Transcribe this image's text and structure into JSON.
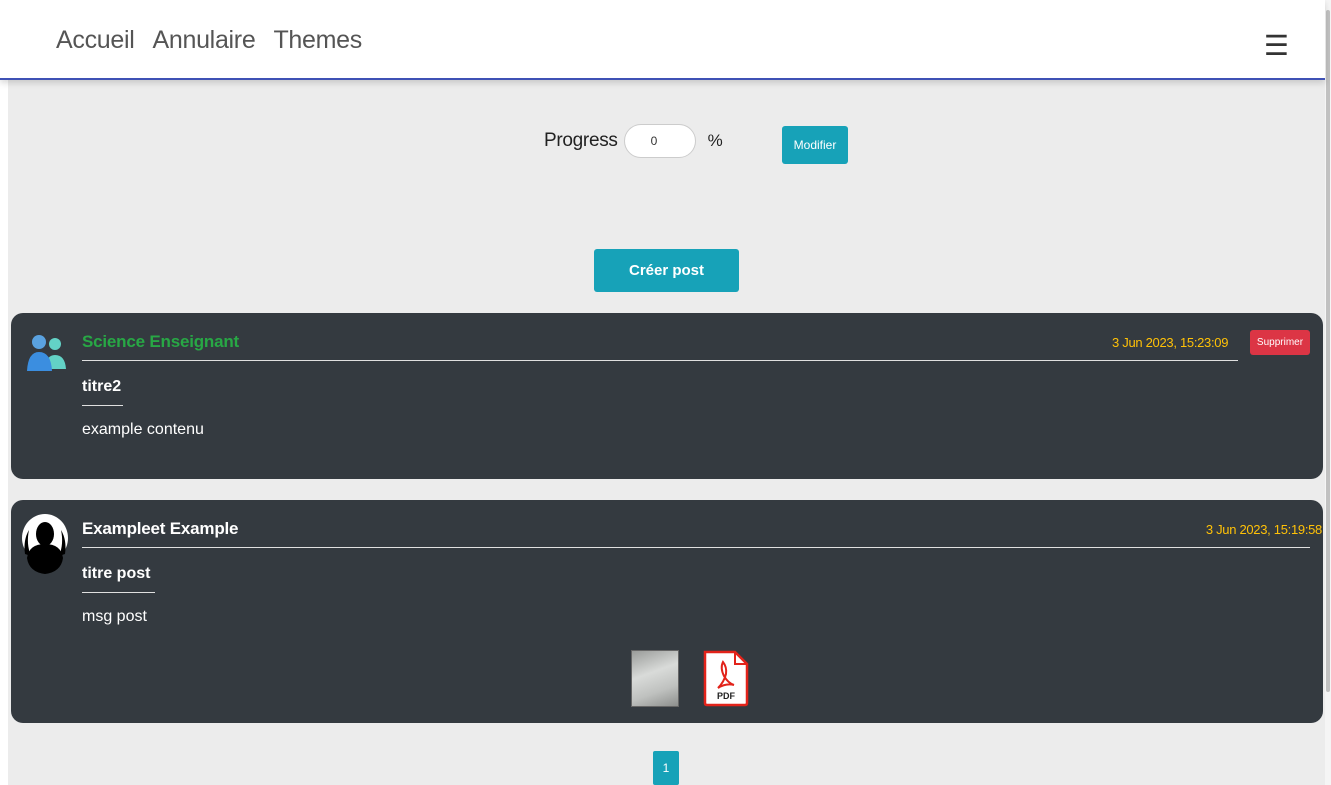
{
  "nav": {
    "links": [
      "Accueil",
      "Annulaire",
      "Themes"
    ],
    "menu_icon": "hamburger-menu-icon"
  },
  "progress": {
    "label": "Progress",
    "value": "0",
    "unit": "%",
    "modify_label": "Modifier"
  },
  "create_post_label": "Créer post",
  "posts": [
    {
      "author": "Science Enseignant",
      "author_color": "#28a745",
      "avatar_icon": "users-group-icon",
      "date": "3 Jun 2023, 15:23:09",
      "delete_label": "Supprimer",
      "title": "titre2",
      "content": "example contenu"
    },
    {
      "author": "Exampleet Example",
      "author_color": "#ffffff",
      "avatar_icon": "user-silhouette-icon",
      "date": "3 Jun 2023, 15:19:58",
      "title": "titre post",
      "content": "msg post",
      "attachments": [
        {
          "type": "image",
          "icon": "image-thumbnail"
        },
        {
          "type": "pdf",
          "label": "PDF",
          "icon": "pdf-file-icon"
        }
      ]
    }
  ],
  "pagination": {
    "current": "1"
  },
  "colors": {
    "accent": "#17a2b8",
    "danger": "#dc3545",
    "date": "#ffc107",
    "card_bg": "#343a40",
    "page_bg": "#ececec",
    "nav_border": "#3f51b5"
  }
}
